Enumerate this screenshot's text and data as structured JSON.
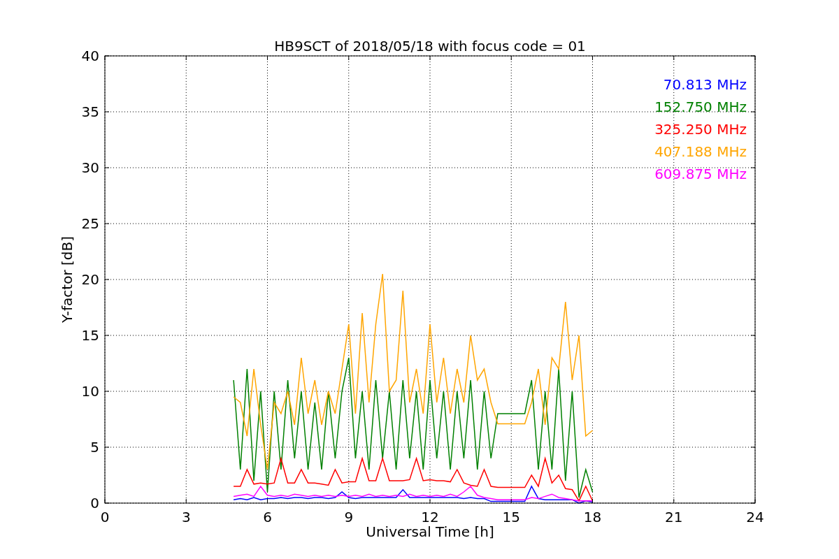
{
  "chart_data": {
    "type": "line",
    "title": "HB9SCT of 2018/05/18 with focus code = 01",
    "xlabel": "Universal Time [h]",
    "ylabel": "Y-factor [dB]",
    "x": [
      4.75,
      5,
      5.25,
      5.5,
      5.75,
      6,
      6.25,
      6.5,
      6.75,
      7,
      7.25,
      7.5,
      7.75,
      8,
      8.25,
      8.5,
      8.75,
      9,
      9.25,
      9.5,
      9.75,
      10,
      10.25,
      10.5,
      10.75,
      11,
      11.25,
      11.5,
      11.75,
      12,
      12.25,
      12.5,
      12.75,
      13,
      13.25,
      13.5,
      13.75,
      14,
      14.25,
      14.5,
      15.5,
      15.75,
      16,
      16.25,
      16.5,
      16.75,
      17,
      17.25,
      17.5,
      17.75,
      18
    ],
    "series": [
      {
        "name": "70.813 MHz",
        "color": "#0000ff",
        "values": [
          0.3,
          0.4,
          0.3,
          0.5,
          0.3,
          0.4,
          0.4,
          0.5,
          0.4,
          0.5,
          0.5,
          0.4,
          0.5,
          0.5,
          0.4,
          0.5,
          1.0,
          0.5,
          0.4,
          0.5,
          0.5,
          0.5,
          0.5,
          0.5,
          0.5,
          1.2,
          0.5,
          0.5,
          0.5,
          0.5,
          0.5,
          0.5,
          0.5,
          0.5,
          0.4,
          0.5,
          0.4,
          0.4,
          0.15,
          0.15,
          0.15,
          1.5,
          0.4,
          0.3,
          0.3,
          0.3,
          0.3,
          0.3,
          0.0,
          0.2,
          0.1
        ]
      },
      {
        "name": "152.750 MHz",
        "color": "#008000",
        "values": [
          11,
          3,
          12,
          2,
          10,
          1,
          10,
          3,
          11,
          4,
          10,
          3,
          9,
          3,
          10,
          4,
          10,
          13,
          4,
          10,
          3,
          11,
          4,
          10,
          3,
          11,
          4,
          10,
          3,
          11,
          4,
          10,
          3,
          10,
          4,
          11,
          3,
          10,
          4,
          8,
          8,
          11,
          3,
          10,
          3,
          12,
          2,
          10,
          0.5,
          3,
          1
        ]
      },
      {
        "name": "325.250 MHz",
        "color": "#ff0000",
        "values": [
          1.5,
          1.5,
          3,
          1.7,
          1.8,
          1.7,
          1.8,
          4,
          1.8,
          1.8,
          3,
          1.8,
          1.8,
          1.7,
          1.6,
          3,
          1.8,
          1.9,
          1.9,
          4,
          2,
          2,
          4,
          2,
          2,
          2,
          2.1,
          4,
          2,
          2.1,
          2,
          2,
          1.9,
          3,
          1.8,
          1.6,
          1.5,
          3,
          1.5,
          1.4,
          1.4,
          2.5,
          1.5,
          4,
          1.8,
          2.5,
          1.3,
          1.2,
          0.2,
          1.5,
          0.2
        ]
      },
      {
        "name": "407.188 MHz",
        "color": "#ffa500",
        "values": [
          9.5,
          9,
          6,
          12,
          7,
          3,
          9,
          8,
          10,
          7,
          13,
          8,
          11,
          7,
          10,
          8,
          12,
          16,
          8,
          17,
          9,
          16,
          20.5,
          10,
          11,
          19,
          9,
          12,
          8,
          16,
          9,
          13,
          8,
          12,
          9,
          15,
          11,
          12,
          9,
          7.1,
          7.1,
          9,
          12,
          7,
          13,
          12,
          18,
          11,
          15,
          6,
          6.5
        ]
      },
      {
        "name": "609.875 MHz",
        "color": "#ff00ff",
        "values": [
          0.6,
          0.7,
          0.8,
          0.6,
          1.5,
          0.7,
          0.6,
          0.7,
          0.6,
          0.8,
          0.7,
          0.6,
          0.7,
          0.6,
          0.7,
          0.6,
          0.7,
          0.6,
          0.7,
          0.6,
          0.8,
          0.6,
          0.7,
          0.6,
          0.7,
          0.6,
          0.8,
          0.6,
          0.7,
          0.6,
          0.7,
          0.6,
          0.8,
          0.6,
          1.0,
          1.5,
          0.7,
          0.5,
          0.4,
          0.3,
          0.3,
          0.5,
          0.4,
          0.6,
          0.8,
          0.5,
          0.4,
          0.3,
          0.2,
          0.2,
          0.2
        ]
      }
    ],
    "xlim": [
      0,
      24
    ],
    "ylim": [
      0,
      40
    ],
    "xticks": [
      0,
      3,
      6,
      9,
      12,
      15,
      18,
      21,
      24
    ],
    "yticks": [
      0,
      5,
      10,
      15,
      20,
      25,
      30,
      35,
      40
    ],
    "grid": true
  }
}
